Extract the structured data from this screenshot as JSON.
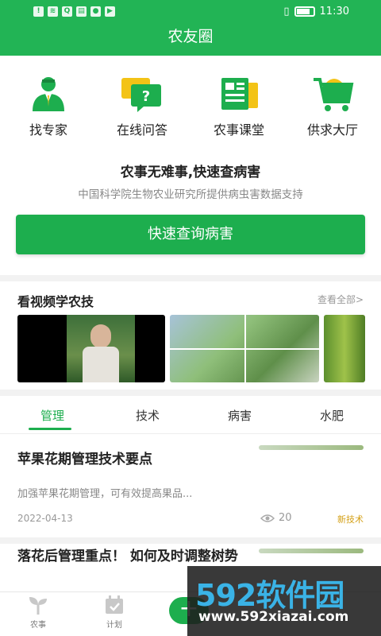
{
  "status": {
    "time": "11:30"
  },
  "title": "农友圈",
  "quick_actions": [
    {
      "label": "找专家",
      "icon": "expert-icon"
    },
    {
      "label": "在线问答",
      "icon": "qa-chat-icon"
    },
    {
      "label": "农事课堂",
      "icon": "classroom-icon"
    },
    {
      "label": "供求大厅",
      "icon": "shopping-cart-icon"
    }
  ],
  "slogan": "农事无难事,快速查病害",
  "subslogan": "中国科学院生物农业研究所提供病虫害数据支持",
  "primary_button": "快速查询病害",
  "videos": {
    "title": "看视频学农技",
    "view_all": "查看全部>"
  },
  "tabs": [
    "管理",
    "技术",
    "病害",
    "水肥"
  ],
  "articles": [
    {
      "title": "苹果花期管理技术要点",
      "summary": "加强苹果花期管理，可有效提高果品...",
      "date": "2022-04-13",
      "views": "20",
      "tag": "新技术"
    },
    {
      "title": "落花后管理重点！ 如何及时调整树势"
    }
  ],
  "bottom_nav": [
    {
      "label": "农事",
      "icon": "seedling-icon"
    },
    {
      "label": "计划",
      "icon": "calendar-icon"
    }
  ],
  "fab_label": "+",
  "watermark": {
    "logo": "592软件园",
    "url": "www.592xiazai.com"
  },
  "colors": {
    "brand_green": "#22b455",
    "tag_gold": "#d4a017"
  }
}
